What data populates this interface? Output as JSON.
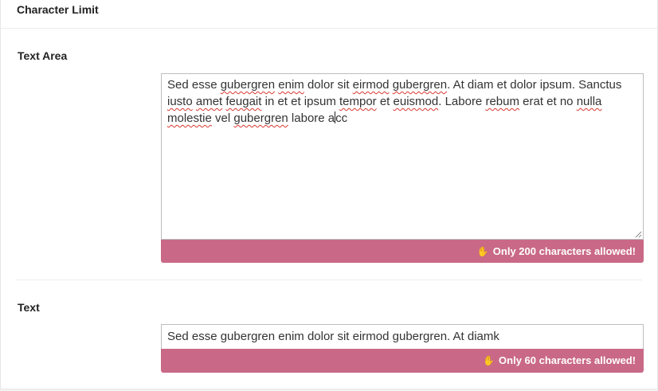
{
  "section": {
    "title": "Character Limit"
  },
  "textarea_field": {
    "label": "Text Area",
    "value_segments": [
      {
        "text": "Sed esse ",
        "misspelled": false
      },
      {
        "text": "gubergren",
        "misspelled": true
      },
      {
        "text": " ",
        "misspelled": false
      },
      {
        "text": "enim",
        "misspelled": true
      },
      {
        "text": " dolor sit ",
        "misspelled": false
      },
      {
        "text": "eirmod",
        "misspelled": true
      },
      {
        "text": " ",
        "misspelled": false
      },
      {
        "text": "gubergren",
        "misspelled": true
      },
      {
        "text": ". At diam et dolor ipsum. Sanctus ",
        "misspelled": false
      },
      {
        "text": "iusto",
        "misspelled": true
      },
      {
        "text": " ",
        "misspelled": false
      },
      {
        "text": "amet",
        "misspelled": true
      },
      {
        "text": " ",
        "misspelled": false
      },
      {
        "text": "feugait",
        "misspelled": true
      },
      {
        "text": " in et et ipsum ",
        "misspelled": false
      },
      {
        "text": "tempor",
        "misspelled": true
      },
      {
        "text": " et ",
        "misspelled": false
      },
      {
        "text": "euismod",
        "misspelled": true
      },
      {
        "text": ". Labore ",
        "misspelled": false
      },
      {
        "text": "rebum",
        "misspelled": true
      },
      {
        "text": " erat et no ",
        "misspelled": false
      },
      {
        "text": "nulla",
        "misspelled": true
      },
      {
        "text": " ",
        "misspelled": false
      },
      {
        "text": "molestie",
        "misspelled": true
      },
      {
        "text": " vel ",
        "misspelled": false
      },
      {
        "text": "gubergren",
        "misspelled": true
      },
      {
        "text": " labore a",
        "misspelled": false
      },
      {
        "caret": true
      },
      {
        "text": "cc",
        "misspelled": false
      }
    ],
    "limit_message": "Only 200 characters allowed!",
    "limit_icon": "hand-stop-icon"
  },
  "text_field": {
    "label": "Text",
    "value": "Sed esse gubergren enim dolor sit eirmod gubergren. At diamk",
    "limit_message": "Only 60 characters allowed!",
    "limit_icon": "hand-stop-icon"
  },
  "colors": {
    "limit_bar": "#c96987",
    "limit_text": "#ffffff",
    "spellcheck_underline": "#d9372f"
  }
}
